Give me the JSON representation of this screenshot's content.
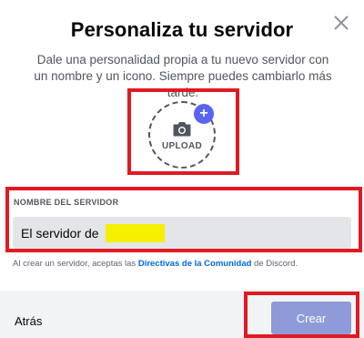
{
  "dialog": {
    "title": "Personaliza tu servidor",
    "subtitle": "Dale una personalidad propia a tu nuevo servidor con un nombre y un icono. Siempre puedes cambiarlo más tarde."
  },
  "upload": {
    "label": "UPLOAD",
    "plus": "+",
    "icon": "camera-icon"
  },
  "server_name": {
    "label": "NOMBRE DEL SERVIDOR",
    "value_prefix": "El servidor de ",
    "redacted": true
  },
  "terms": {
    "prefix": "Al crear un servidor, aceptas las ",
    "link": "Directivas de la Comunidad",
    "suffix": " de Discord."
  },
  "footer": {
    "back_label": "Atrás",
    "create_label": "Crear"
  },
  "colors": {
    "accent": "#5865f2",
    "create_button": "#8e9bd8",
    "annotation": "#e01a22",
    "redaction": "#f5f000"
  }
}
